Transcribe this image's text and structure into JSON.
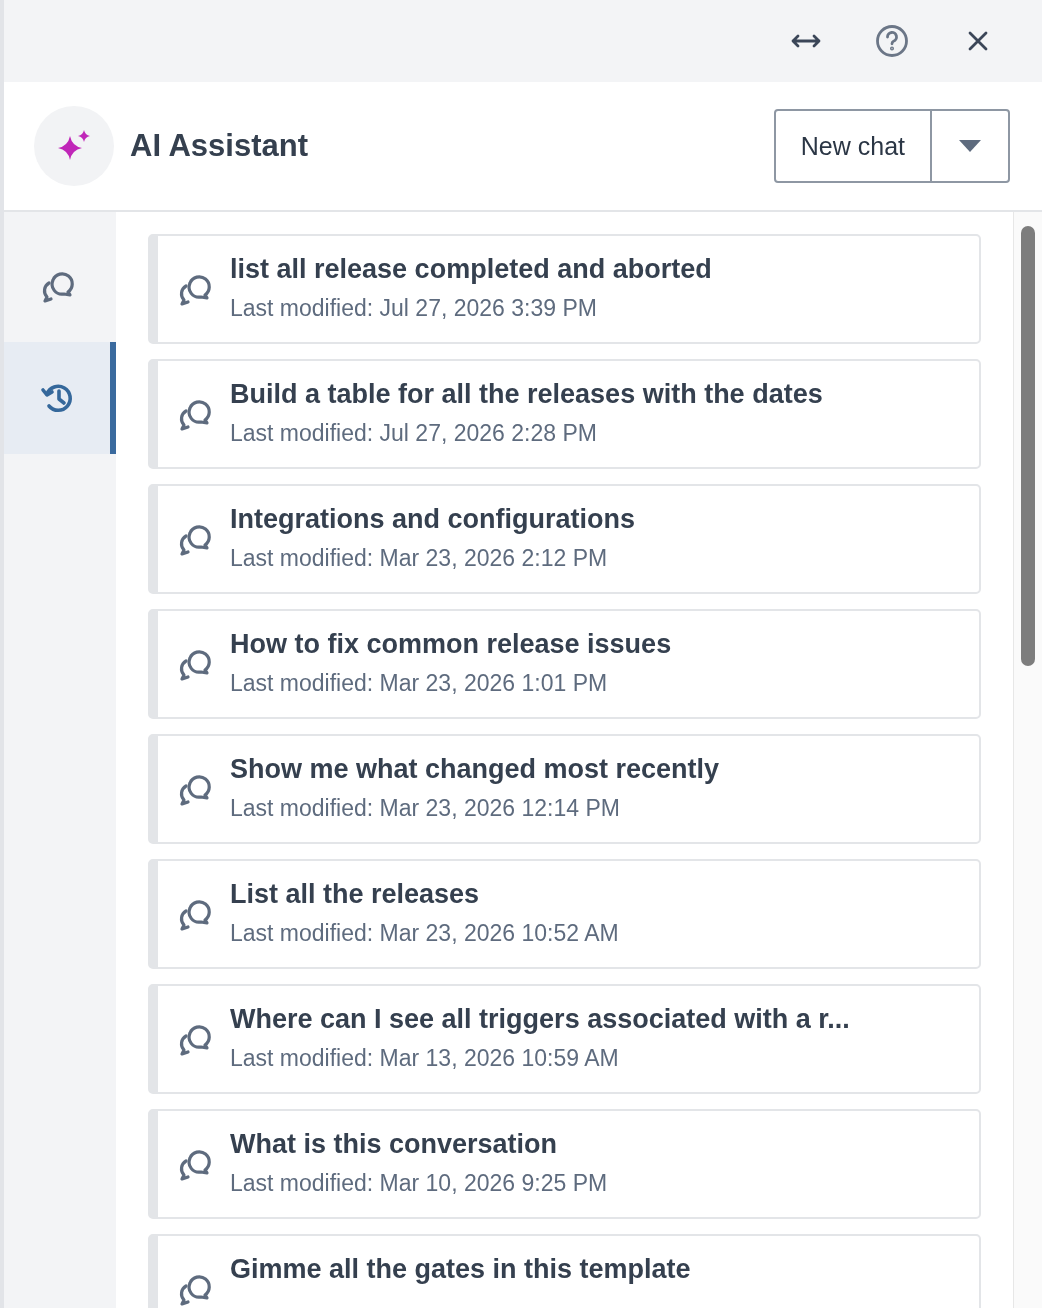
{
  "header": {
    "title": "AI Assistant",
    "new_chat_button": "New chat"
  },
  "rail_tabs": [
    {
      "kind": "chats",
      "selected": false
    },
    {
      "kind": "history",
      "selected": true
    }
  ],
  "conversations": [
    {
      "title": "list all release completed and aborted",
      "modified": "Last modified: Jul 27, 2026 3:39 PM"
    },
    {
      "title": "Build a table for all the releases with the dates",
      "modified": "Last modified: Jul 27, 2026 2:28 PM"
    },
    {
      "title": "Integrations and configurations",
      "modified": "Last modified: Mar 23, 2026 2:12 PM"
    },
    {
      "title": "How to fix common release issues",
      "modified": "Last modified: Mar 23, 2026 1:01 PM"
    },
    {
      "title": "Show me what changed most recently",
      "modified": "Last modified: Mar 23, 2026 12:14 PM"
    },
    {
      "title": "List all the releases",
      "modified": "Last modified: Mar 23, 2026 10:52 AM"
    },
    {
      "title": "Where can I see all triggers associated with a r...",
      "modified": "Last modified: Mar 13, 2026 10:59 AM"
    },
    {
      "title": "What is this conversation",
      "modified": "Last modified: Mar 10, 2026 9:25 PM"
    },
    {
      "title": "Gimme all the gates in this template"
    }
  ]
}
